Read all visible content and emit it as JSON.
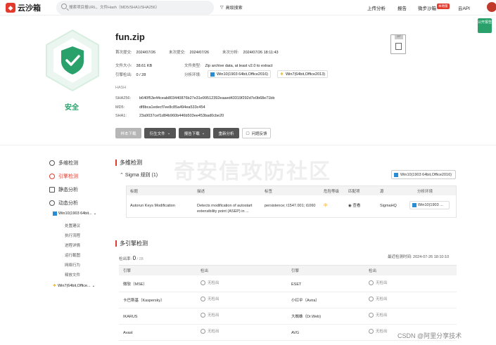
{
  "topbar": {
    "logo": "云沙箱",
    "search_placeholder": "搜索项目报URL、文件Hash（MD5/SHA1/SHA256）",
    "advanced_search": "高级搜索",
    "nav": [
      "上传分析",
      "报告",
      "微步沙箱",
      "云API"
    ],
    "new_badge": "本地版",
    "public_report": "公开报告"
  },
  "file": {
    "name": "fun.zip",
    "first_submit_label": "首次提交:",
    "first_submit": "2024/07/26",
    "last_submit_label": "末次提交:",
    "last_submit": "2024/07/26",
    "last_analysis_label": "末次分析:",
    "last_analysis": "2024/07/26 18:11:43",
    "size_label": "文件大小:",
    "size": "38.61 KB",
    "type_label": "文件类型:",
    "type": "Zip archive data, at least v2.0 to extract",
    "engine_label": "引擎检出:",
    "engine": "0 / 28",
    "env_label": "分析环境:",
    "envs": [
      "Win10(1903 64bit,Office2016)",
      "Win7(64bit,Office2013)"
    ],
    "verdict": "安全"
  },
  "hash": {
    "title": "HASH",
    "sha256_label": "SHA256:",
    "sha256": "b640f53e44ceab803440876b27e31e99512392eaaed43319f292d7e0b68e71bb",
    "md5_label": "MD5:",
    "md5": "df8bca1edecf7ee8c85a494ea533c454",
    "sha1_label": "SHA1:",
    "sha1": "23a9037cef1d84b960b446b503ee453bad0cbe20"
  },
  "actions": {
    "sample_download": "样本下载",
    "derived_files": "衍生文件",
    "report_download": "报告下载",
    "reanalyze": "重新分析",
    "feedback": "问题反馈"
  },
  "sidebar": {
    "items": [
      "多维检测",
      "引擎检测",
      "静态分析",
      "动态分析"
    ],
    "env1": "Win10(1903 64bit...",
    "sub": [
      "处置建议",
      "执行流程",
      "进程详情",
      "运行截图",
      "网络行为",
      "释放文件"
    ],
    "env2": "Win7(64bit,Office..."
  },
  "multi": {
    "title": "多维检测",
    "sigma": "Sigma 规则 (1)",
    "env": "Win10(1903 64bit,Office2016)",
    "headers": [
      "标题",
      "描述",
      "标签",
      "危险等级",
      "匹配项",
      "源",
      "分析环境"
    ],
    "row": {
      "title": "Autorun Keys Modification",
      "desc": "Detects modification of autostart extensibility point (ASEP) in ...",
      "tags": "persistence; t1547.001; t1060",
      "level": "中",
      "match": "查看",
      "source": "SigmaHQ",
      "env": "Win10(1903 ..."
    }
  },
  "engines": {
    "title": "多引擎检测",
    "rate_label": "检出率:",
    "rate_num": "0",
    "rate_total": "/ 28",
    "last_time": "最近检测时间: 2024-07-26 18:10:10",
    "headers": [
      "引擎",
      "检出",
      "引擎",
      "检出"
    ],
    "result": "无检出",
    "rows": [
      [
        "微软（MSE）",
        "ESET"
      ],
      [
        "卡巴斯基（Kaspersky）",
        "小红伞（Avira）"
      ],
      [
        "IKARUS",
        "大蜘蛛（Dr.Web)"
      ],
      [
        "Avast",
        "AVG"
      ]
    ]
  },
  "watermark": "奇安信攻防社区",
  "footer": "CSDN @阿里分享技术"
}
